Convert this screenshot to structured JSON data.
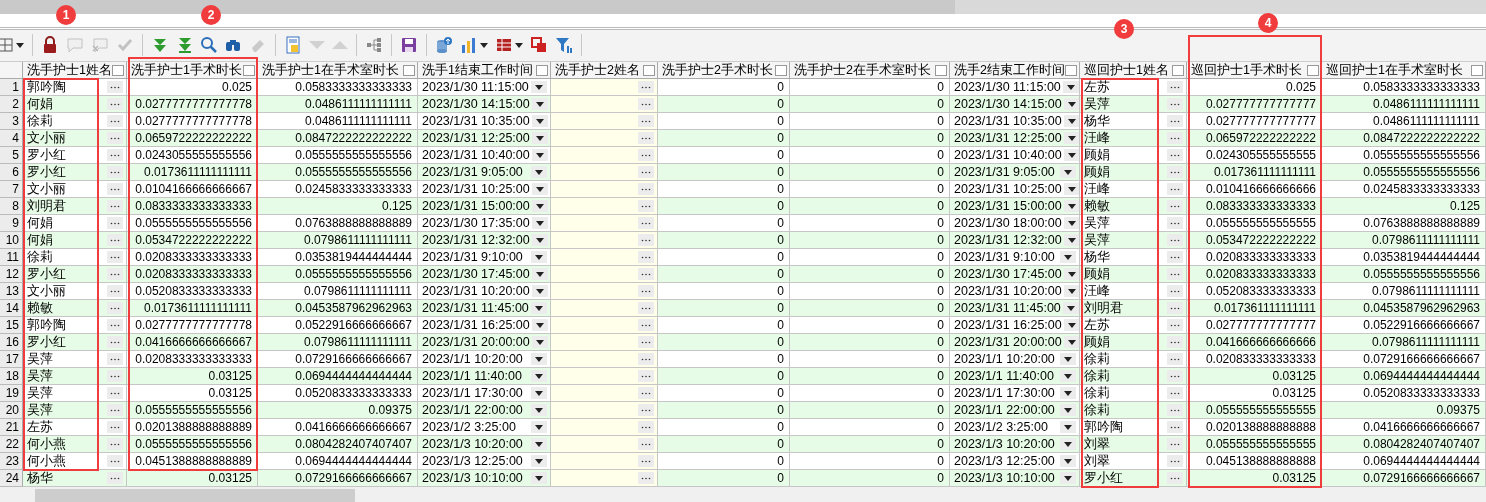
{
  "toolbar": {
    "groups": [
      [
        {
          "kind": "grid",
          "disabled": false,
          "dropdown": true
        }
      ],
      [
        {
          "kind": "lock",
          "disabled": false,
          "dropdown": false
        },
        {
          "kind": "comment",
          "disabled": true,
          "dropdown": false
        },
        {
          "kind": "comment-x",
          "disabled": true,
          "dropdown": false
        },
        {
          "kind": "check",
          "disabled": true,
          "dropdown": false
        }
      ],
      [
        {
          "kind": "double-down",
          "disabled": false,
          "dropdown": false
        },
        {
          "kind": "double-down-bar",
          "disabled": false,
          "dropdown": false
        },
        {
          "kind": "search",
          "disabled": false,
          "dropdown": false
        },
        {
          "kind": "binoculars",
          "disabled": false,
          "dropdown": false
        },
        {
          "kind": "eraser",
          "disabled": true,
          "dropdown": false
        }
      ],
      [
        {
          "kind": "form",
          "disabled": false,
          "dropdown": false
        },
        {
          "kind": "triangle-down",
          "disabled": true,
          "dropdown": false
        },
        {
          "kind": "triangle-up",
          "disabled": true,
          "dropdown": false
        }
      ],
      [
        {
          "kind": "tree",
          "disabled": false,
          "dropdown": false
        }
      ],
      [
        {
          "kind": "save",
          "disabled": false,
          "dropdown": false
        }
      ],
      [
        {
          "kind": "database",
          "disabled": false,
          "dropdown": false
        },
        {
          "kind": "bar-chart",
          "disabled": false,
          "dropdown": true
        },
        {
          "kind": "table",
          "disabled": false,
          "dropdown": true
        },
        {
          "kind": "copy",
          "disabled": false,
          "dropdown": false
        },
        {
          "kind": "filter",
          "disabled": false,
          "dropdown": false
        }
      ]
    ]
  },
  "table": {
    "columns": [
      {
        "label": "洗手护士1姓名",
        "kind": "name",
        "highlighted": false
      },
      {
        "label": "洗手护士1手术时长",
        "kind": "number",
        "highlighted": false
      },
      {
        "label": "洗手护士1在手术室时长",
        "kind": "number",
        "highlighted": false
      },
      {
        "label": "洗手1结束工作时间",
        "kind": "datetime",
        "highlighted": false
      },
      {
        "label": "洗手护士2姓名",
        "kind": "name",
        "highlighted": true
      },
      {
        "label": "洗手护士2手术时长",
        "kind": "number",
        "highlighted": false
      },
      {
        "label": "洗手护士2在手术室时长",
        "kind": "number",
        "highlighted": false
      },
      {
        "label": "洗手2结束工作时间",
        "kind": "datetime",
        "highlighted": false
      },
      {
        "label": "巡回护士1姓名",
        "kind": "name",
        "highlighted": false
      },
      {
        "label": "巡回护士1手术时长",
        "kind": "number",
        "highlighted": false
      },
      {
        "label": "巡回护士1在手术室时长",
        "kind": "number",
        "highlighted": false
      }
    ],
    "rows": [
      {
        "number": "1",
        "cells": [
          "郭吟陶",
          "0.025",
          "0.0583333333333333",
          "2023/1/30 11:15:00",
          null,
          "0",
          "0",
          "2023/1/30 11:15:00",
          "左苏",
          "0.025",
          "0.0583333333333333"
        ]
      },
      {
        "number": "2",
        "cells": [
          "何娟",
          "0.0277777777777778",
          "0.0486111111111111",
          "2023/1/30 14:15:00",
          null,
          "0",
          "0",
          "2023/1/30 14:15:00",
          "吴萍",
          "0.027777777777777",
          "0.0486111111111111"
        ]
      },
      {
        "number": "3",
        "cells": [
          "徐莉",
          "0.0277777777777778",
          "0.0486111111111111",
          "2023/1/31 10:35:00",
          null,
          "0",
          "0",
          "2023/1/31 10:35:00",
          "杨华",
          "0.027777777777777",
          "0.0486111111111111"
        ]
      },
      {
        "number": "4",
        "cells": [
          "文小丽",
          "0.0659722222222222",
          "0.0847222222222222",
          "2023/1/31 12:25:00",
          null,
          "0",
          "0",
          "2023/1/31 12:25:00",
          "汪峰",
          "0.065972222222222",
          "0.0847222222222222"
        ]
      },
      {
        "number": "5",
        "cells": [
          "罗小红",
          "0.0243055555555556",
          "0.0555555555555556",
          "2023/1/31 10:40:00",
          null,
          "0",
          "0",
          "2023/1/31 10:40:00",
          "顾娟",
          "0.024305555555555",
          "0.0555555555555556"
        ]
      },
      {
        "number": "6",
        "cells": [
          "罗小红",
          "0.0173611111111111",
          "0.0555555555555556",
          "2023/1/31 9:05:00",
          null,
          "0",
          "0",
          "2023/1/31 9:05:00",
          "顾娟",
          "0.017361111111111",
          "0.0555555555555556"
        ]
      },
      {
        "number": "7",
        "cells": [
          "文小丽",
          "0.0104166666666667",
          "0.0245833333333333",
          "2023/1/31 10:25:00",
          null,
          "0",
          "0",
          "2023/1/31 10:25:00",
          "汪峰",
          "0.010416666666666",
          "0.0245833333333333"
        ]
      },
      {
        "number": "8",
        "cells": [
          "刘明君",
          "0.0833333333333333",
          "0.125",
          "2023/1/31 15:00:00",
          null,
          "0",
          "0",
          "2023/1/31 15:00:00",
          "赖敏",
          "0.083333333333333",
          "0.125"
        ]
      },
      {
        "number": "9",
        "cells": [
          "何娟",
          "0.0555555555555556",
          "0.0763888888888889",
          "2023/1/30 17:35:00",
          null,
          "0",
          "0",
          "2023/1/30 18:00:00",
          "吴萍",
          "0.055555555555555",
          "0.0763888888888889"
        ]
      },
      {
        "number": "10",
        "cells": [
          "何娟",
          "0.0534722222222222",
          "0.0798611111111111",
          "2023/1/31 12:32:00",
          null,
          "0",
          "0",
          "2023/1/31 12:32:00",
          "吴萍",
          "0.053472222222222",
          "0.0798611111111111"
        ]
      },
      {
        "number": "11",
        "cells": [
          "徐莉",
          "0.0208333333333333",
          "0.0353819444444444",
          "2023/1/31 9:10:00",
          null,
          "0",
          "0",
          "2023/1/31 9:10:00",
          "杨华",
          "0.020833333333333",
          "0.0353819444444444"
        ]
      },
      {
        "number": "12",
        "cells": [
          "罗小红",
          "0.0208333333333333",
          "0.0555555555555556",
          "2023/1/30 17:45:00",
          null,
          "0",
          "0",
          "2023/1/30 17:45:00",
          "顾娟",
          "0.020833333333333",
          "0.0555555555555556"
        ]
      },
      {
        "number": "13",
        "cells": [
          "文小丽",
          "0.0520833333333333",
          "0.0798611111111111",
          "2023/1/31 10:20:00",
          null,
          "0",
          "0",
          "2023/1/31 10:20:00",
          "汪峰",
          "0.052083333333333",
          "0.0798611111111111"
        ]
      },
      {
        "number": "14",
        "cells": [
          "赖敏",
          "0.0173611111111111",
          "0.0453587962962963",
          "2023/1/31 11:45:00",
          null,
          "0",
          "0",
          "2023/1/31 11:45:00",
          "刘明君",
          "0.017361111111111",
          "0.0453587962962963"
        ]
      },
      {
        "number": "15",
        "cells": [
          "郭吟陶",
          "0.0277777777777778",
          "0.0522916666666667",
          "2023/1/31 16:25:00",
          null,
          "0",
          "0",
          "2023/1/31 16:25:00",
          "左苏",
          "0.027777777777777",
          "0.0522916666666667"
        ]
      },
      {
        "number": "16",
        "cells": [
          "罗小红",
          "0.0416666666666667",
          "0.0798611111111111",
          "2023/1/31 20:00:00",
          null,
          "0",
          "0",
          "2023/1/31 20:00:00",
          "顾娟",
          "0.041666666666666",
          "0.0798611111111111"
        ]
      },
      {
        "number": "17",
        "cells": [
          "吴萍",
          "0.0208333333333333",
          "0.0729166666666667",
          "2023/1/1 10:20:00",
          null,
          "0",
          "0",
          "2023/1/1 10:20:00",
          "徐莉",
          "0.020833333333333",
          "0.0729166666666667"
        ]
      },
      {
        "number": "18",
        "cells": [
          "吴萍",
          "0.03125",
          "0.0694444444444444",
          "2023/1/1 11:40:00",
          null,
          "0",
          "0",
          "2023/1/1 11:40:00",
          "徐莉",
          "0.03125",
          "0.0694444444444444"
        ]
      },
      {
        "number": "19",
        "cells": [
          "吴萍",
          "0.03125",
          "0.0520833333333333",
          "2023/1/1 17:30:00",
          null,
          "0",
          "0",
          "2023/1/1 17:30:00",
          "徐莉",
          "0.03125",
          "0.0520833333333333"
        ]
      },
      {
        "number": "20",
        "cells": [
          "吴萍",
          "0.0555555555555556",
          "0.09375",
          "2023/1/1 22:00:00",
          null,
          "0",
          "0",
          "2023/1/1 22:00:00",
          "徐莉",
          "0.055555555555555",
          "0.09375"
        ]
      },
      {
        "number": "21",
        "cells": [
          "左苏",
          "0.0201388888888889",
          "0.0416666666666667",
          "2023/1/2 3:25:00",
          null,
          "0",
          "0",
          "2023/1/2 3:25:00",
          "郭吟陶",
          "0.020138888888888",
          "0.0416666666666667"
        ]
      },
      {
        "number": "22",
        "cells": [
          "何小燕",
          "0.0555555555555556",
          "0.0804282407407407",
          "2023/1/3 10:20:00",
          null,
          "0",
          "0",
          "2023/1/3 10:20:00",
          "刘翠",
          "0.055555555555555",
          "0.0804282407407407"
        ]
      },
      {
        "number": "23",
        "cells": [
          "何小燕",
          "0.0451388888888889",
          "0.0694444444444444",
          "2023/1/3 12:25:00",
          null,
          "0",
          "0",
          "2023/1/3 12:25:00",
          "刘翠",
          "0.045138888888888",
          "0.0694444444444444"
        ]
      },
      {
        "number": "24",
        "cells": [
          "杨华",
          "0.03125",
          "0.0729166666666667",
          "2023/1/3 10:10:00",
          null,
          "0",
          "0",
          "2023/1/3 10:10:00",
          "罗小红",
          "0.03125",
          "0.0729166666666667"
        ]
      }
    ]
  },
  "annotations": [
    {
      "label": "1"
    },
    {
      "label": "2"
    },
    {
      "label": "3"
    },
    {
      "label": "4"
    }
  ]
}
